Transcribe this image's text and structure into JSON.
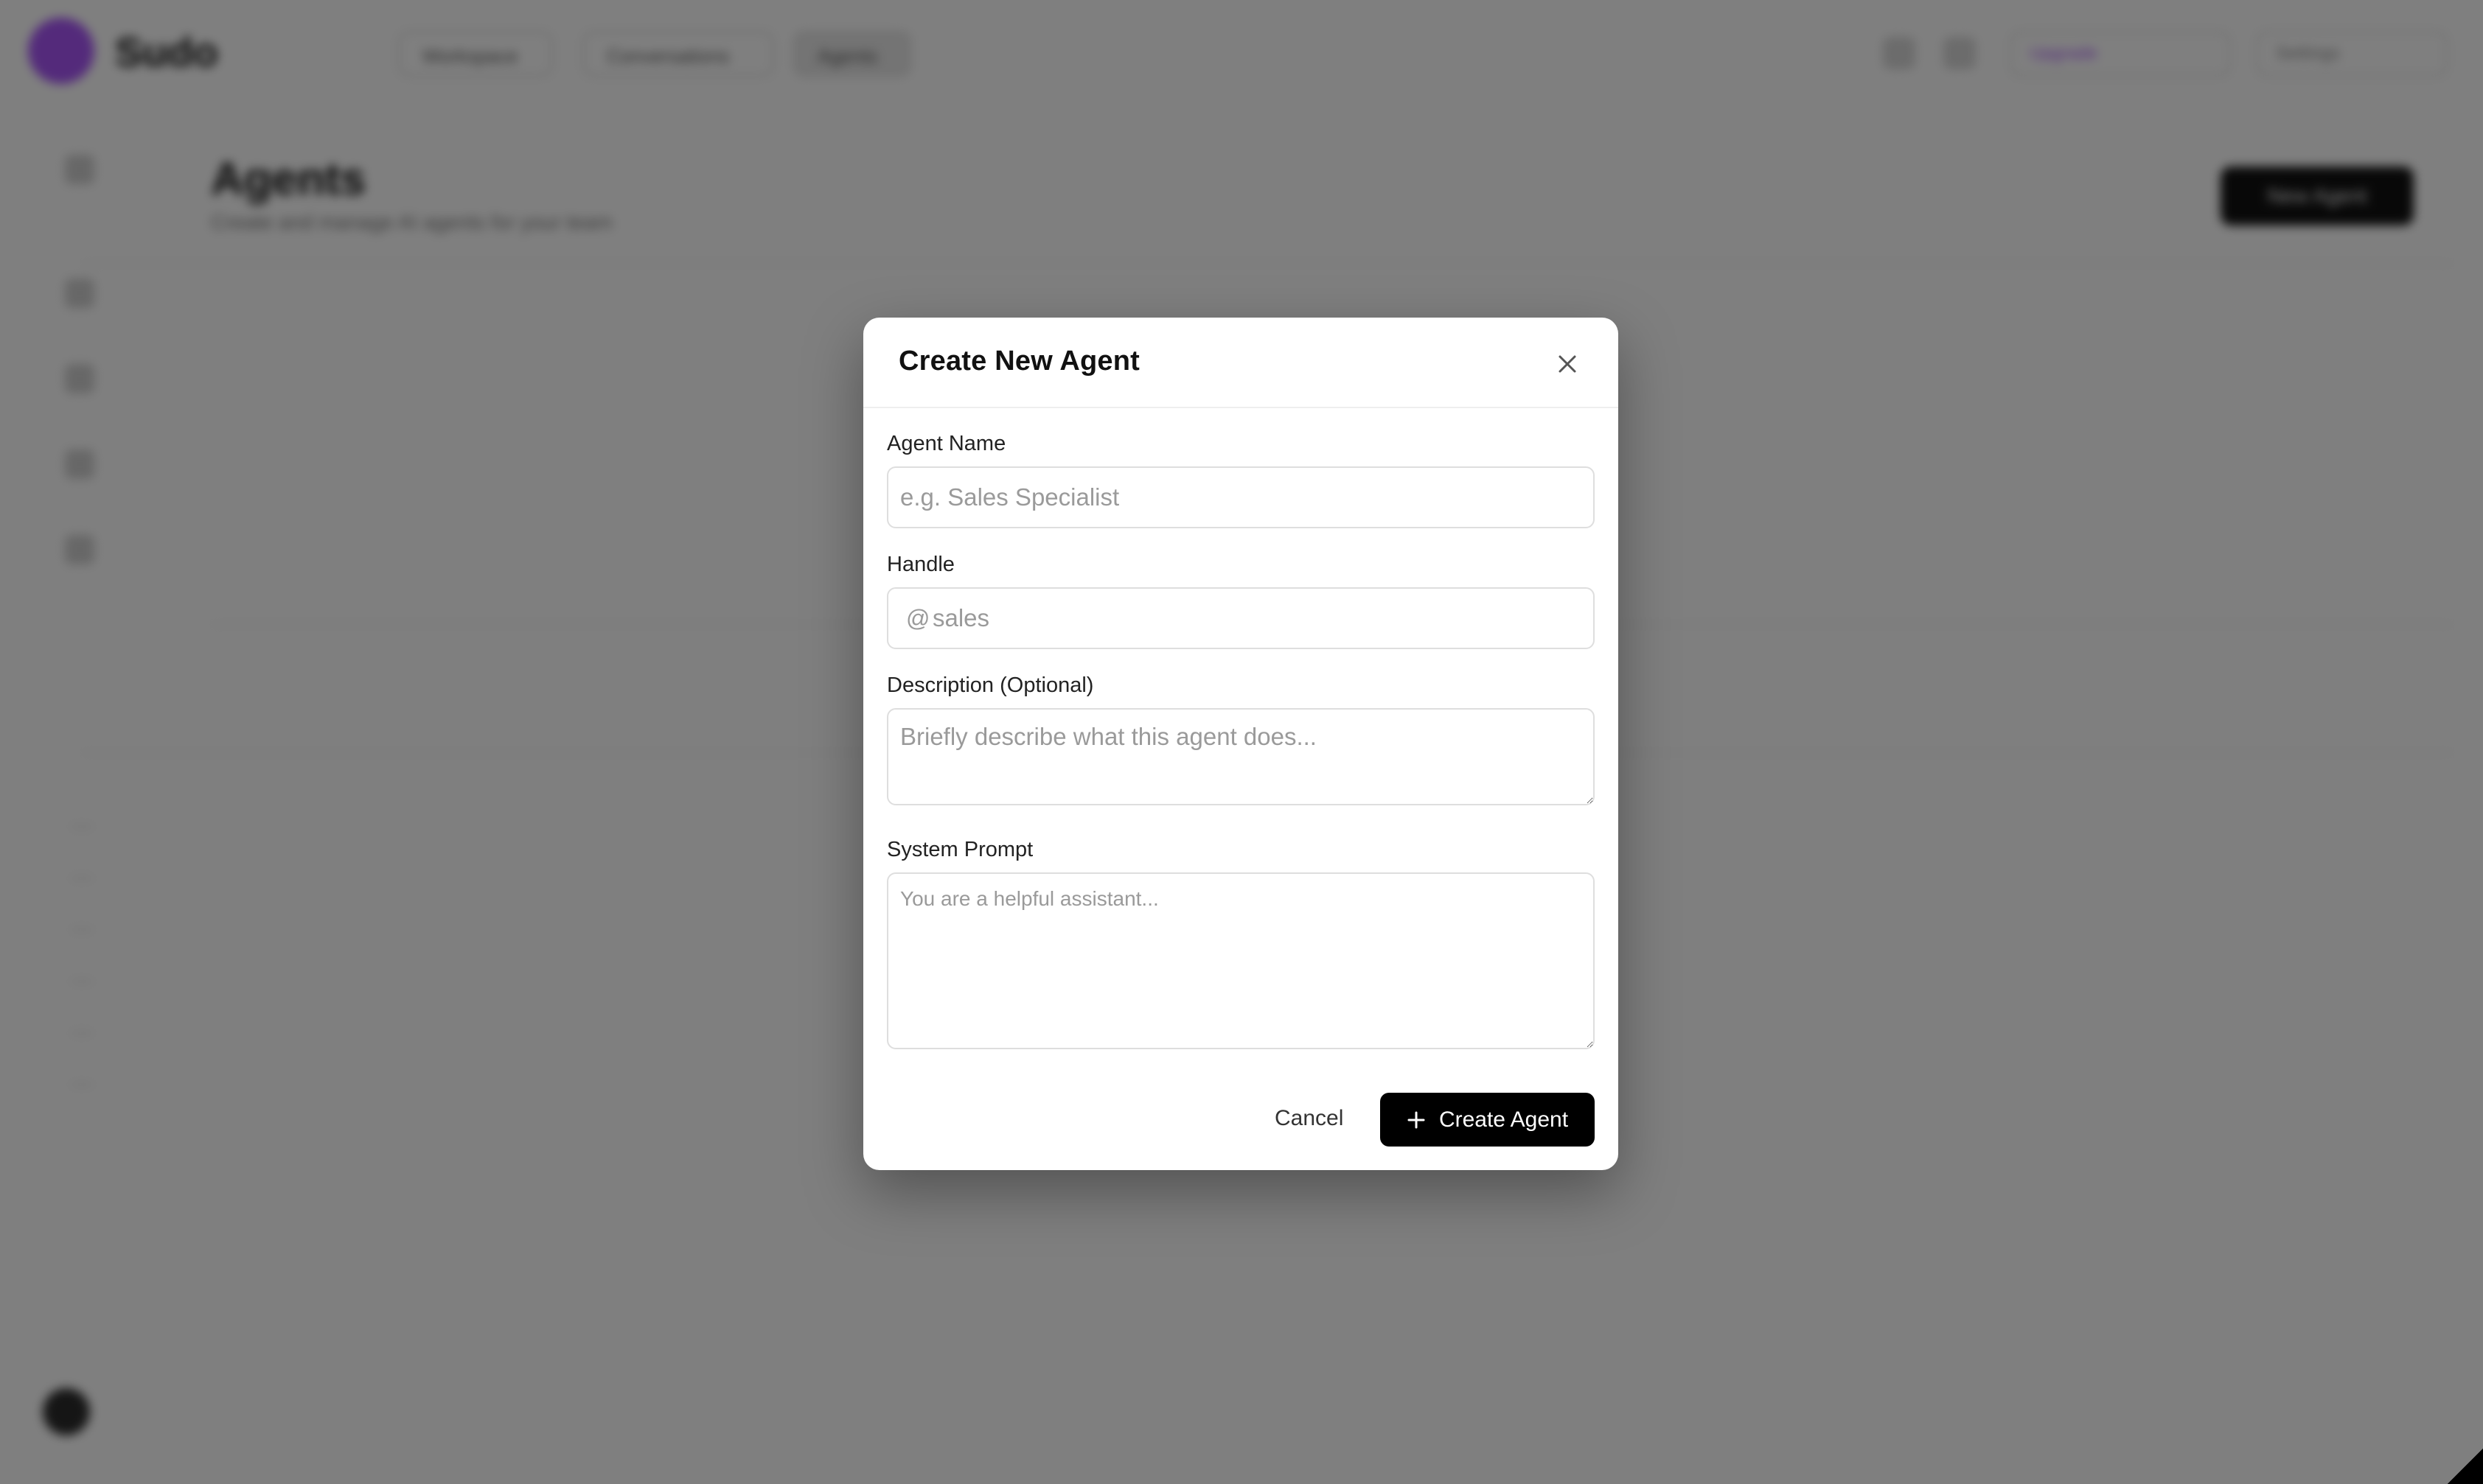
{
  "background": {
    "app_name": "Sudo",
    "nav_tabs": [
      "Workspace",
      "Conversations",
      "Agents"
    ],
    "page_title": "Agents",
    "page_subtitle": "Create and manage AI agents for your team",
    "new_button": "New Agent",
    "top_pills": [
      "Upgrade",
      "Settings"
    ]
  },
  "modal": {
    "title": "Create New Agent",
    "fields": {
      "agent_name": {
        "label": "Agent Name",
        "value": "",
        "placeholder": "e.g. Sales Specialist"
      },
      "handle": {
        "label": "Handle",
        "prefix": "@",
        "value": "",
        "placeholder": "sales"
      },
      "description": {
        "label": "Description (Optional)",
        "value": "",
        "placeholder": "Briefly describe what this agent does..."
      },
      "system_prompt": {
        "label": "System Prompt",
        "value": "",
        "placeholder": "You are a helpful assistant..."
      }
    },
    "cancel_label": "Cancel",
    "create_label": "Create Agent"
  },
  "colors": {
    "overlay": "rgba(0,0,0,0.5)",
    "primary_button": "#000000",
    "brand_accent": "#a855f7"
  },
  "icons": {
    "close": "close-icon",
    "create": "plus-icon"
  }
}
